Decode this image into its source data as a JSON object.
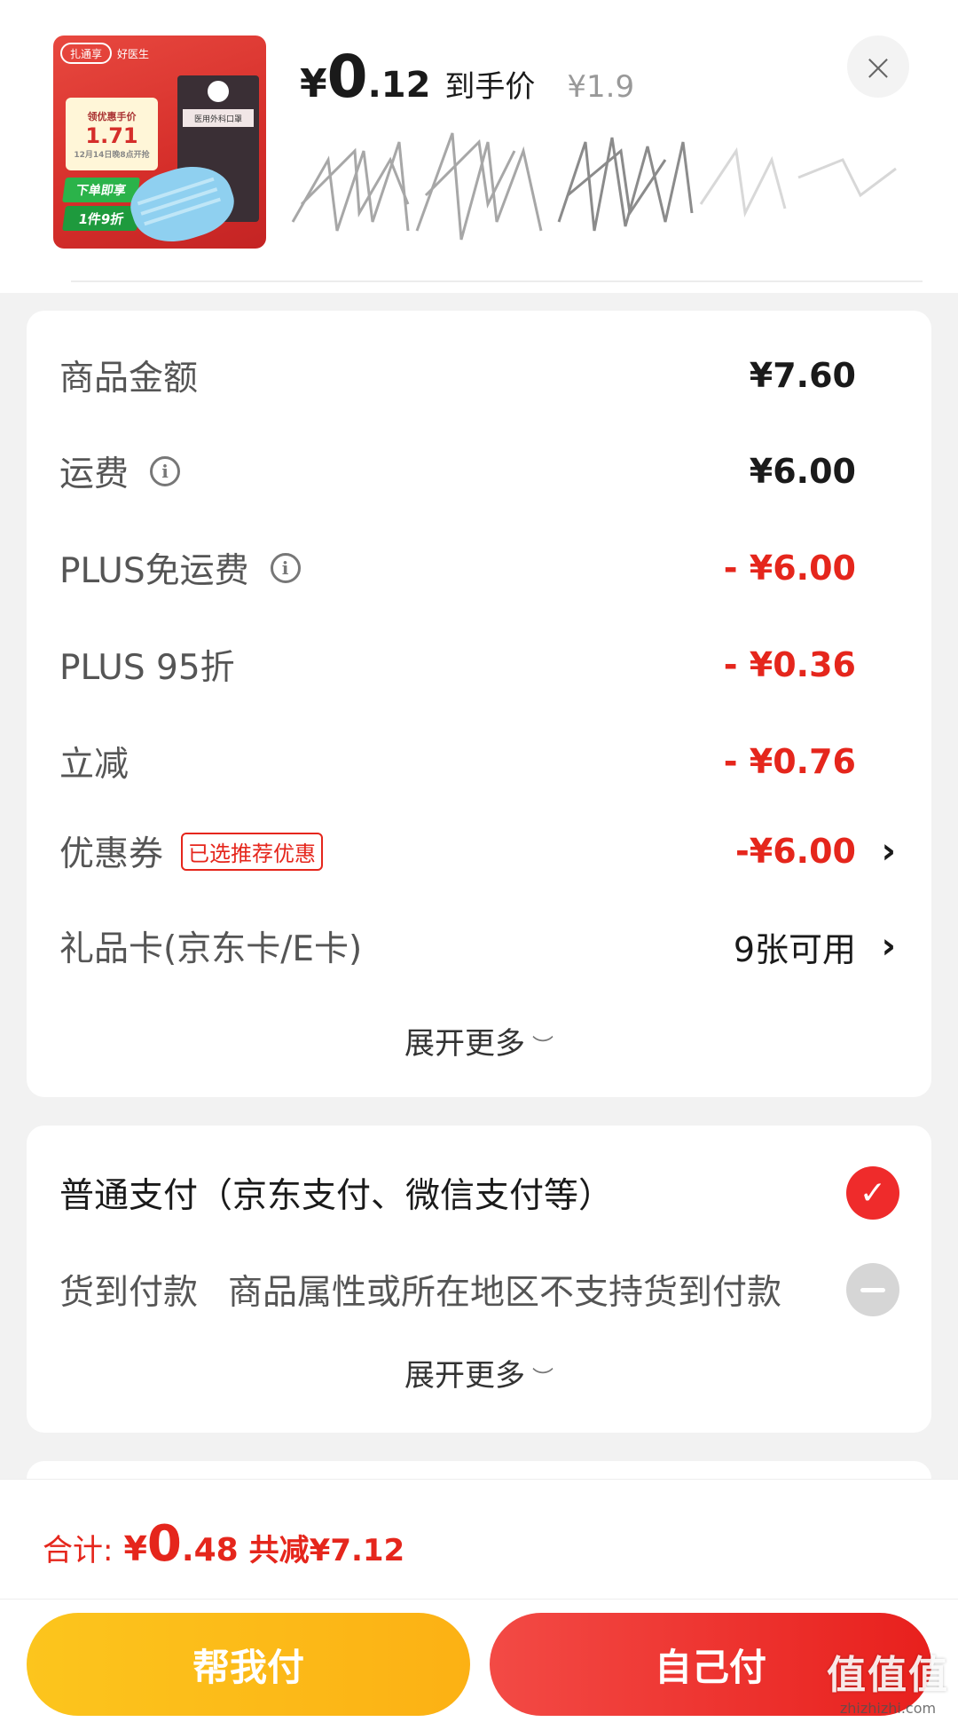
{
  "product": {
    "thumb_tag_left": "扎通享",
    "thumb_tag_right": "好医生",
    "thumb_card_line1": "领优惠手价",
    "thumb_card_price": "1.71",
    "thumb_card_line3": "12月14日晚8点开抢",
    "thumb_badge1": "下单即享",
    "thumb_badge2": "1件9折",
    "thumb_pack_label": "医用外科口罩",
    "price_symbol": "¥",
    "price_int": "0",
    "price_dec": ".12",
    "price_label": "到手价",
    "price_original": "¥1.9",
    "close": "×"
  },
  "fees": {
    "goods_label": "商品金额",
    "goods_value": "¥7.60",
    "shipping_label": "运费",
    "shipping_value": "¥6.00",
    "plus_free_label": "PLUS免运费",
    "plus_free_value": "- ¥6.00",
    "plus_discount_label": "PLUS 95折",
    "plus_discount_value": "- ¥0.36",
    "instant_label": "立减",
    "instant_value": "- ¥0.76",
    "coupon_label": "优惠券",
    "coupon_badge": "已选推荐优惠",
    "coupon_value": "-¥6.00",
    "giftcard_label": "礼品卡(京东卡/E卡)",
    "giftcard_value": "9张可用",
    "expand": "展开更多",
    "info_glyph": "i",
    "chevron_glyph": "›",
    "expand_glyph": "︶"
  },
  "payment": {
    "normal_label": "普通支付（京东支付、微信支付等）",
    "cod_label": "货到付款",
    "cod_note": "商品属性或所在地区不支持货到付款",
    "expand": "展开更多",
    "check_glyph": "✓",
    "expand_glyph": "︶"
  },
  "bottom": {
    "total_label": "合计:",
    "total_symbol": "¥",
    "total_int": "0",
    "total_dec": ".48",
    "total_save": "共减¥7.12",
    "help_pay": "帮我付",
    "self_pay": "自己付"
  },
  "watermark": {
    "main": "值值值",
    "sub": "zhizhizhi.com"
  },
  "colors": {
    "accent_red": "#e5261c",
    "check_red": "#ef2b2b",
    "help_yellow": "#fcb114",
    "self_red": "#e8201d"
  },
  "icons": [
    "close-icon",
    "info-icon",
    "chevron-right-icon",
    "chevron-down-icon",
    "check-icon",
    "disabled-icon"
  ]
}
